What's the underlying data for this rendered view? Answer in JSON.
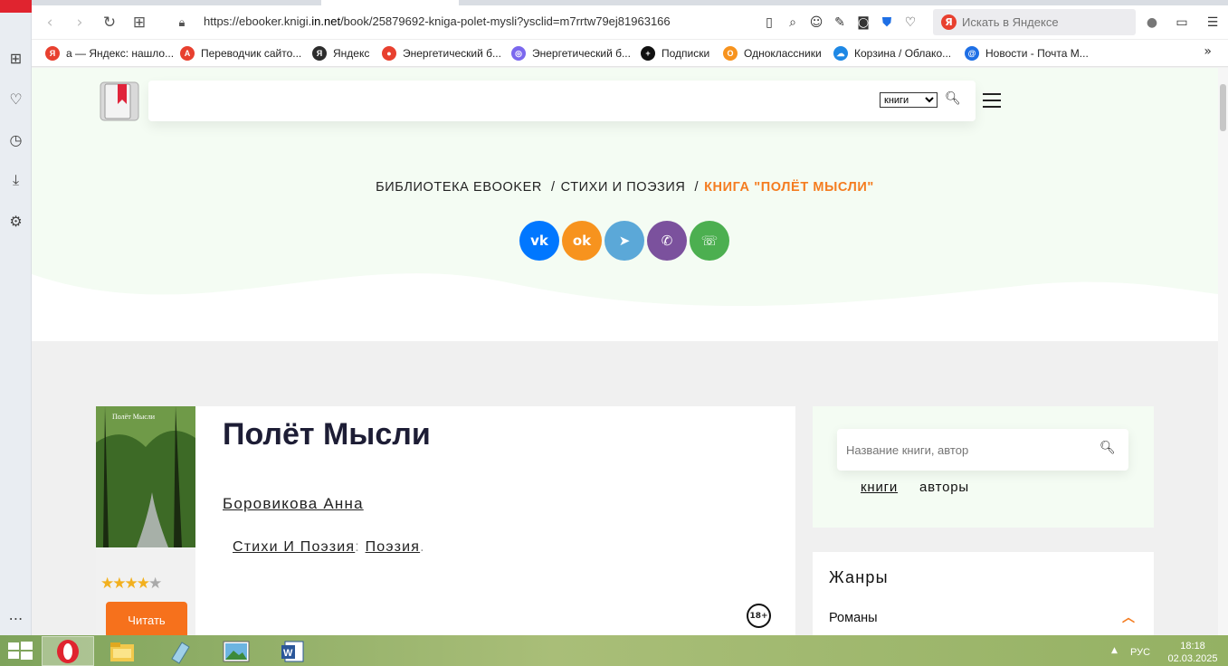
{
  "browser": {
    "url_prefix": "https://ebooker.knigi.",
    "url_domain": "in.net",
    "url_rest": "/book/25879692-kniga-polet-mysli?ysclid=m7rrtw79ej81963166",
    "search_placeholder": "Искать в Яндексе",
    "bookmarks": [
      {
        "label": "а — Яндекс: нашло...",
        "color": "#e8402f",
        "glyph": "Я"
      },
      {
        "label": "Переводчик сайто...",
        "color": "#e8402f",
        "glyph": "A"
      },
      {
        "label": "Яндекс",
        "color": "#2d2d2d",
        "glyph": "Я"
      },
      {
        "label": "Энергетический б...",
        "color": "#e8402f",
        "glyph": "●"
      },
      {
        "label": "Энергетический б...",
        "color": "#7b68ee",
        "glyph": "◎"
      },
      {
        "label": "Подписки",
        "color": "#111111",
        "glyph": "+"
      },
      {
        "label": "Одноклассники",
        "color": "#f7931e",
        "glyph": "O"
      },
      {
        "label": "Корзина / Облако...",
        "color": "#1e88e5",
        "glyph": "☁"
      },
      {
        "label": "Новости - Почта М...",
        "color": "#1e6fe5",
        "glyph": "@"
      }
    ],
    "more": "»"
  },
  "site": {
    "search_category": "книги",
    "breadcrumb": [
      "БИБЛИОТЕКА EBOOKER",
      "СТИХИ И ПОЭЗИЯ",
      "КНИГА \"ПОЛЁТ МЫСЛИ\""
    ],
    "breadcrumb_sep": "/",
    "share": [
      {
        "name": "vk",
        "color": "#0077ff",
        "glyph": "vk"
      },
      {
        "name": "odnoklassniki",
        "color": "#f7931e",
        "glyph": "ok"
      },
      {
        "name": "telegram",
        "color": "#5ba8d8",
        "glyph": "➤"
      },
      {
        "name": "viber",
        "color": "#7b519d",
        "glyph": "✆"
      },
      {
        "name": "whatsapp",
        "color": "#4caf50",
        "glyph": "☏"
      }
    ]
  },
  "book": {
    "title": "Полёт Мысли",
    "author": "Боровикова Анна",
    "genre": "Стихи И Поэзия",
    "subgenre": "Поэзия",
    "genre_sep": ":",
    "end_dot": ".",
    "rating": 4,
    "rating_max": 5,
    "read_label": "Читать",
    "age": "18+",
    "cover_title": "Полёт Мысли"
  },
  "sidebar": {
    "search_placeholder": "Название книги, автор",
    "tab_books": "книги",
    "tab_authors": "авторы",
    "genres_title": "Жанры",
    "first_genre": "Романы"
  },
  "taskbar": {
    "lang": "РУС",
    "time": "18:18",
    "date": "02.03.2025"
  }
}
